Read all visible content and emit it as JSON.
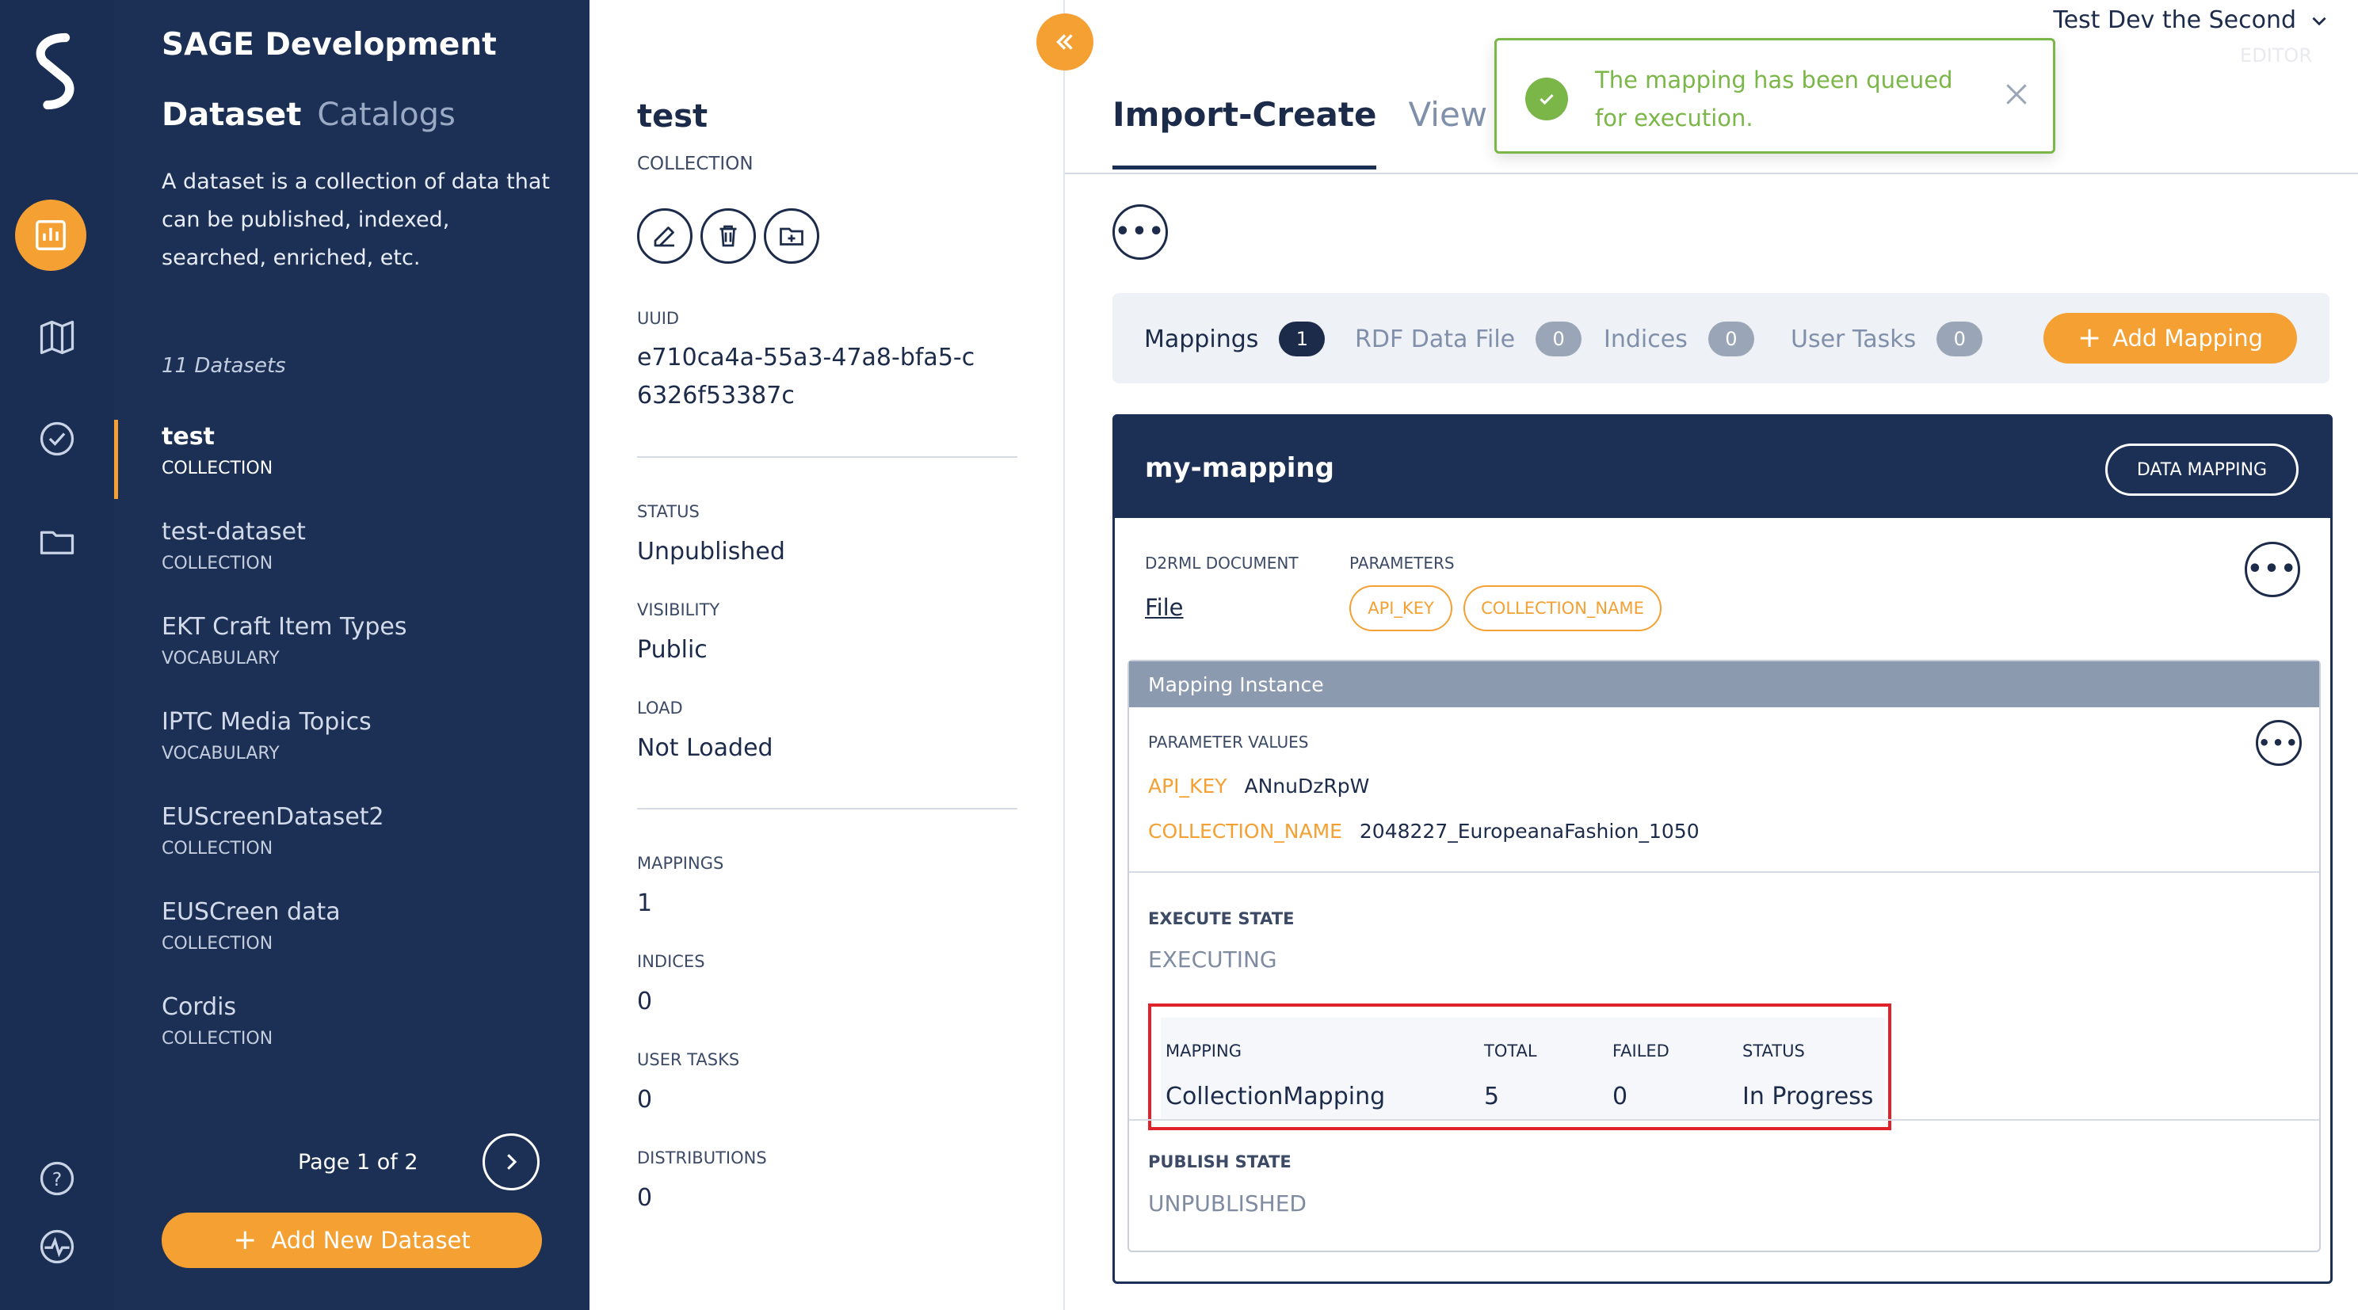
{
  "colors": {
    "accent": "#f5a033",
    "navy": "#1c3055",
    "rail": "#1a2d52",
    "success": "#7ab648",
    "highlight_border": "#e0232a"
  },
  "rail": {
    "logo_icon": "sage-logo-icon",
    "items": [
      "dashboard-icon",
      "map-icon",
      "check-circle-icon",
      "folder-icon"
    ],
    "bottom_items": [
      "help-icon",
      "activity-icon"
    ]
  },
  "datasets_panel": {
    "brand": "SAGE Development",
    "tabs": {
      "active": "Dataset",
      "other": "Catalogs"
    },
    "description": "A dataset is a collection of data that can be published, indexed, searched, enriched, etc.",
    "count": "11 Datasets",
    "items": [
      {
        "name": "test",
        "type": "COLLECTION"
      },
      {
        "name": "test-dataset",
        "type": "COLLECTION"
      },
      {
        "name": "EKT Craft Item Types",
        "type": "VOCABULARY"
      },
      {
        "name": "IPTC Media Topics",
        "type": "VOCABULARY"
      },
      {
        "name": "EUScreenDataset2",
        "type": "COLLECTION"
      },
      {
        "name": "EUSCreen data",
        "type": "COLLECTION"
      },
      {
        "name": "Cordis",
        "type": "COLLECTION"
      }
    ],
    "pagination": "Page 1 of 2",
    "add_button": "Add New Dataset"
  },
  "detail_panel": {
    "title": "test",
    "subtitle": "COLLECTION",
    "actions": [
      "edit-icon",
      "delete-icon",
      "add-folder-icon"
    ],
    "uuid_label": "UUID",
    "uuid": "e710ca4a-55a3-47a8-bfa5-c6326f53387c",
    "status_label": "STATUS",
    "status": "Unpublished",
    "visibility_label": "VISIBILITY",
    "visibility": "Public",
    "load_label": "LOAD",
    "load": "Not Loaded",
    "mappings_label": "MAPPINGS",
    "mappings": "1",
    "indices_label": "INDICES",
    "indices": "0",
    "user_tasks_label": "USER TASKS",
    "user_tasks": "0",
    "distributions_label": "DISTRIBUTIONS",
    "distributions": "0"
  },
  "header": {
    "user": "Test Dev the Second",
    "role": "EDITOR"
  },
  "main": {
    "tabs": [
      "Import-Create",
      "View and Annotate"
    ],
    "sub_tabs": [
      {
        "label": "Mappings",
        "count": "1"
      },
      {
        "label": "RDF Data File",
        "count": "0"
      },
      {
        "label": "Indices",
        "count": "0"
      },
      {
        "label": "User Tasks",
        "count": "0"
      }
    ],
    "add_mapping": "Add Mapping"
  },
  "mapping": {
    "name": "my-mapping",
    "data_mapping_button": "DATA MAPPING",
    "d2rml_label": "D2RML DOCUMENT",
    "file_link": "File",
    "parameters_label": "PARAMETERS",
    "parameters": [
      "API_KEY",
      "COLLECTION_NAME"
    ],
    "instance": {
      "header": "Mapping Instance",
      "param_values_label": "PARAMETER VALUES",
      "param_values": [
        {
          "key": "API_KEY",
          "value": "ANnuDzRpW"
        },
        {
          "key": "COLLECTION_NAME",
          "value": "2048227_EuropeanaFashion_1050"
        }
      ],
      "execute_state_label": "EXECUTE STATE",
      "execute_state": "EXECUTING",
      "table": {
        "headers": [
          "MAPPING",
          "TOTAL",
          "FAILED",
          "STATUS"
        ],
        "row": [
          "CollectionMapping",
          "5",
          "0",
          "In Progress"
        ]
      },
      "publish_state_label": "PUBLISH STATE",
      "publish_state": "UNPUBLISHED"
    }
  },
  "toast": {
    "message": "The mapping has been queued for execution.",
    "icon": "check-icon"
  }
}
